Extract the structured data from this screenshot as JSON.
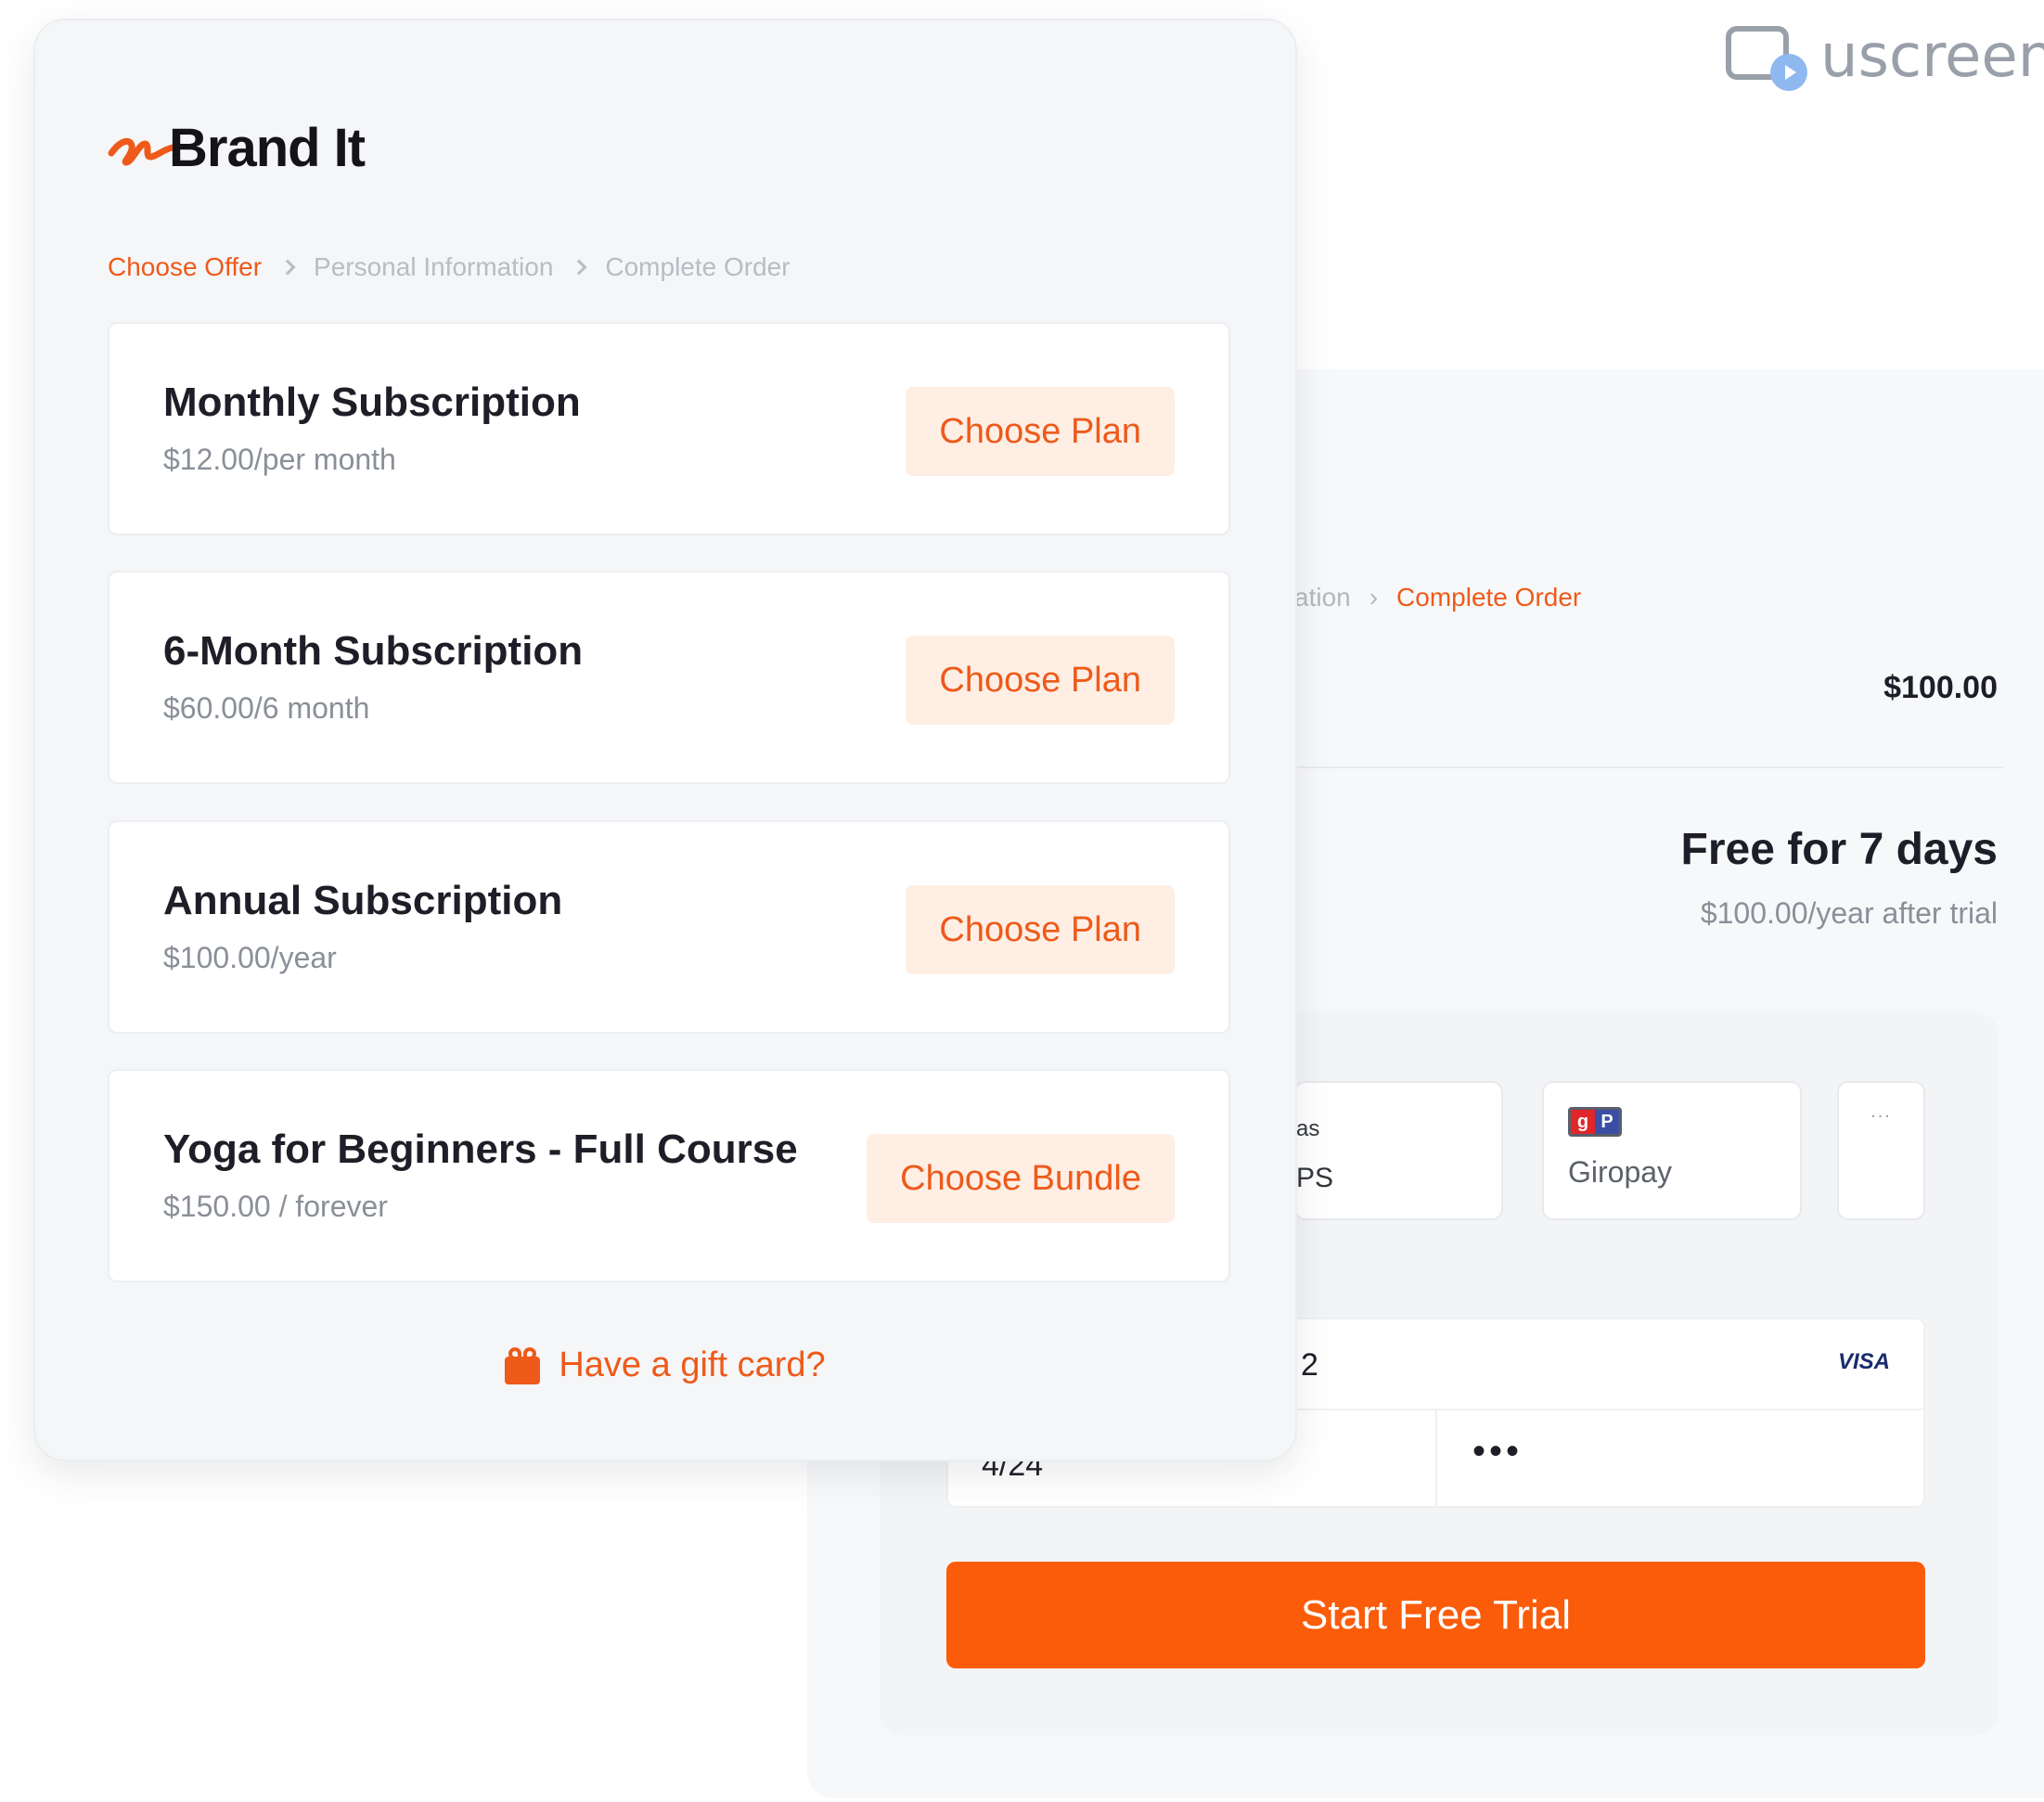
{
  "branding": {
    "product_logo_text": "uscreen",
    "brand_name": "Brand It",
    "accent_color": "#ee5a1a",
    "cta_color": "#fb5c0a"
  },
  "offer": {
    "breadcrumb": [
      {
        "label": "Choose Offer",
        "active": true
      },
      {
        "label": "Personal Information",
        "active": false
      },
      {
        "label": "Complete Order",
        "active": false
      }
    ],
    "plans": [
      {
        "title": "Monthly Subscription",
        "price": "$12.00/per month",
        "button": "Choose Plan"
      },
      {
        "title": "6-Month Subscription",
        "price": "$60.00/6 month",
        "button": "Choose Plan"
      },
      {
        "title": "Annual Subscription",
        "price": "$100.00/year",
        "button": "Choose Plan"
      },
      {
        "title": "Yoga for Beginners - Full Course",
        "price": "$150.00 / forever",
        "button": "Choose Bundle"
      }
    ],
    "gift_card_link": "Have a gift card?"
  },
  "checkout": {
    "breadcrumb_partial": "ation",
    "breadcrumb_active": "Complete Order",
    "total_price": "$100.00",
    "trial_title": "Free for 7 days",
    "trial_subtitle": "$100.00/year after trial",
    "payment_methods": [
      {
        "label_top": "as",
        "label_bottom": "PS"
      },
      {
        "label": "Giropay",
        "badge_left": "g",
        "badge_right": "P"
      },
      {
        "label": "..."
      }
    ],
    "card": {
      "number_fragment": "2",
      "brand": "VISA",
      "expiry_fragment": "4/24",
      "cvc_masked": "•••"
    },
    "submit_label": "Start Free Trial"
  }
}
